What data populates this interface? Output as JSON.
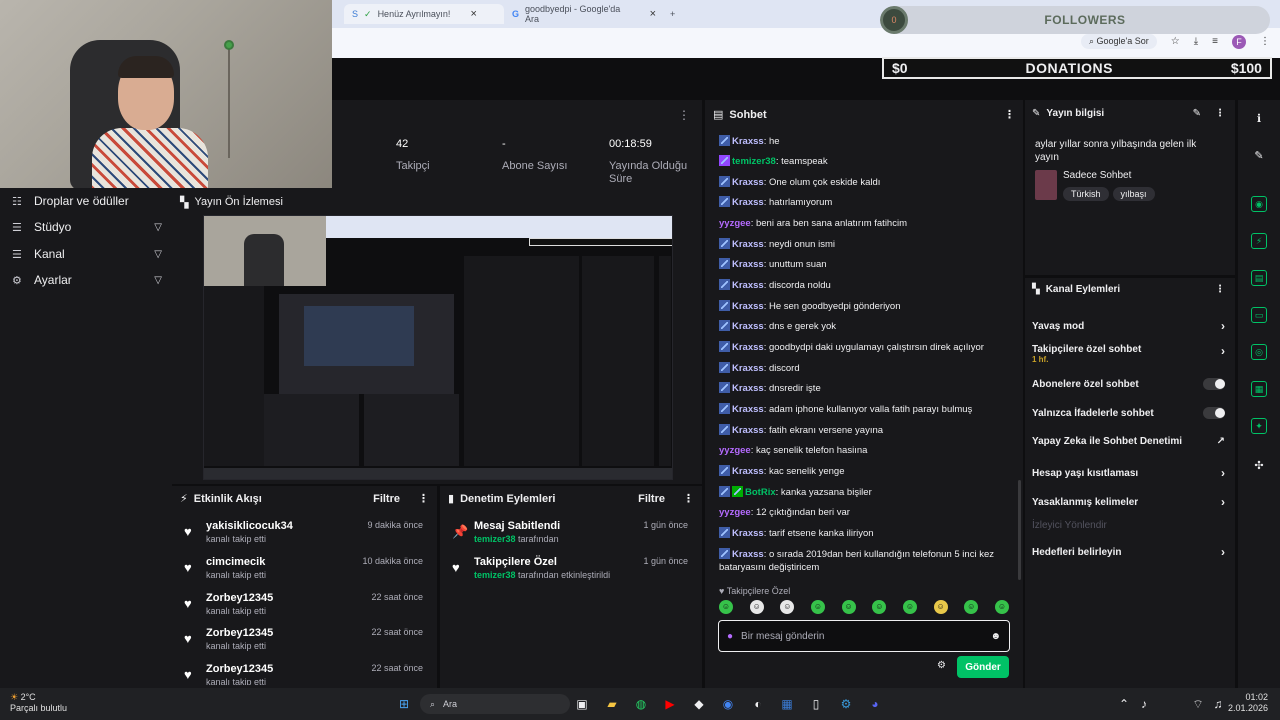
{
  "browser": {
    "tabs": [
      {
        "label": "Henüz Ayrılmayın!"
      },
      {
        "label": "goodbyedpi - Google'da Ara"
      }
    ],
    "search_chip": "Google'a Sor",
    "profile_initial": "F"
  },
  "overlay": {
    "followers_label": "FOLLOWERS",
    "followers_pill": "0",
    "donations_label": "DONATIONS",
    "donations_current": "$0",
    "donations_goal": "$100"
  },
  "stats": [
    {
      "value": "42",
      "label": "Takipçi"
    },
    {
      "value": "-",
      "label": "Abone Sayısı"
    },
    {
      "value": "00:18:59",
      "label": "Yayında Olduğu Süre"
    }
  ],
  "leftnav": [
    {
      "label": "Droplar ve ödüller"
    },
    {
      "label": "Stüdyo"
    },
    {
      "label": "Kanal"
    },
    {
      "label": "Ayarlar"
    }
  ],
  "preview": {
    "title": "Yayın Ön İzlemesi"
  },
  "activity": {
    "title": "Etkinlik Akışı",
    "filter": "Filtre",
    "items": [
      {
        "name": "yakisiklicocuk34",
        "sub": "kanalı takip etti",
        "time": "9 dakika önce"
      },
      {
        "name": "cimcimecik",
        "sub": "kanalı takip etti",
        "time": "10 dakika önce"
      },
      {
        "name": "Zorbey12345",
        "sub": "kanalı takip etti",
        "time": "22 saat önce"
      },
      {
        "name": "Zorbey12345",
        "sub": "kanalı takip etti",
        "time": "22 saat önce"
      },
      {
        "name": "Zorbey12345",
        "sub": "kanalı takip etti",
        "time": "22 saat önce"
      }
    ]
  },
  "modlog": {
    "title": "Denetim Eylemleri",
    "filter": "Filtre",
    "items": [
      {
        "name": "Mesaj Sabitlendi",
        "actor": "temizer38",
        "sub": "tarafından",
        "time": "1 gün önce"
      },
      {
        "name": "Takipçilere Özel",
        "actor": "temizer38",
        "sub": "tarafından etkinleştirildi",
        "time": "1 gün önce"
      }
    ]
  },
  "chat": {
    "title": "Sohbet",
    "messages": [
      {
        "user": "Kraxss",
        "text": "he"
      },
      {
        "user": "temizer38",
        "text": "teamspeak"
      },
      {
        "user": "Kraxss",
        "text": "One olum çok eskide kaldı"
      },
      {
        "user": "Kraxss",
        "text": "hatırlamıyorum"
      },
      {
        "user": "yyzgee",
        "text": "beni ara ben sana anlatırım fatihcim"
      },
      {
        "user": "Kraxss",
        "text": "neydi onun ismi"
      },
      {
        "user": "Kraxss",
        "text": "unuttum suan"
      },
      {
        "user": "Kraxss",
        "text": "discorda noldu"
      },
      {
        "user": "Kraxss",
        "text": "He sen goodbyedpi gönderiyon"
      },
      {
        "user": "Kraxss",
        "text": "dns e gerek yok"
      },
      {
        "user": "Kraxss",
        "text": "goodbydpi daki uygulamayı çalıştırsın direk açılıyor"
      },
      {
        "user": "Kraxss",
        "text": "discord"
      },
      {
        "user": "Kraxss",
        "text": "dnsredir işte"
      },
      {
        "user": "Kraxss",
        "text": "adam iphone kullanıyor valla fatih parayı bulmuş"
      },
      {
        "user": "Kraxss",
        "text": "fatih ekranı versene yayına"
      },
      {
        "user": "yyzgee",
        "text": "kaç senelik telefon hasiına"
      },
      {
        "user": "Kraxss",
        "text": "kac senelik yenge"
      },
      {
        "user": "BotRix",
        "text": "kanka yazsana bişiler"
      },
      {
        "user": "yyzgee",
        "text": "12 çıktığından beri var"
      },
      {
        "user": "Kraxss",
        "text": "tarif etsene kanka iliriyon"
      },
      {
        "user": "Kraxss",
        "text": "o sırada 2019dan beri kullandığın telefonun 5 inci kez bataryasını değiştiricem"
      }
    ],
    "mode_label": "Takipçilere Özel",
    "input_placeholder": "Bir mesaj gönderin",
    "send_label": "Gönder"
  },
  "info": {
    "title": "Yayın bilgisi",
    "stream_title": "aylar yıllar sonra yılbaşında gelen ilk yayın",
    "category": "Sadece Sohbet",
    "tags": [
      "Türkish",
      "yılbaşı"
    ]
  },
  "actions": {
    "title": "Kanal Eylemleri",
    "rows": [
      {
        "label": "Yavaş mod",
        "sub": ""
      },
      {
        "label": "Takipçilere özel sohbet",
        "sub": "1 hf."
      },
      {
        "label": "Abonelere özel sohbet",
        "sub": ""
      },
      {
        "label": "Yalnızca İfadelerle sohbet",
        "sub": ""
      },
      {
        "label": "Yapay Zeka ile Sohbet Denetimi",
        "sub": ""
      },
      {
        "label": "Hesap yaşı kısıtlaması",
        "sub": ""
      },
      {
        "label": "Yasaklanmış kelimeler",
        "sub": ""
      },
      {
        "label": "İzleyici Yönlendir",
        "sub": ""
      },
      {
        "label": "Hedefleri belirleyin",
        "sub": ""
      }
    ]
  },
  "taskbar": {
    "temp": "2°C",
    "weather": "Parçalı bulutlu",
    "search": "Ara",
    "time": "01:02",
    "date": "2.01.2026"
  },
  "colors": {
    "accent": "#00c266",
    "panel": "#18181b",
    "bg": "#0e0e10"
  }
}
